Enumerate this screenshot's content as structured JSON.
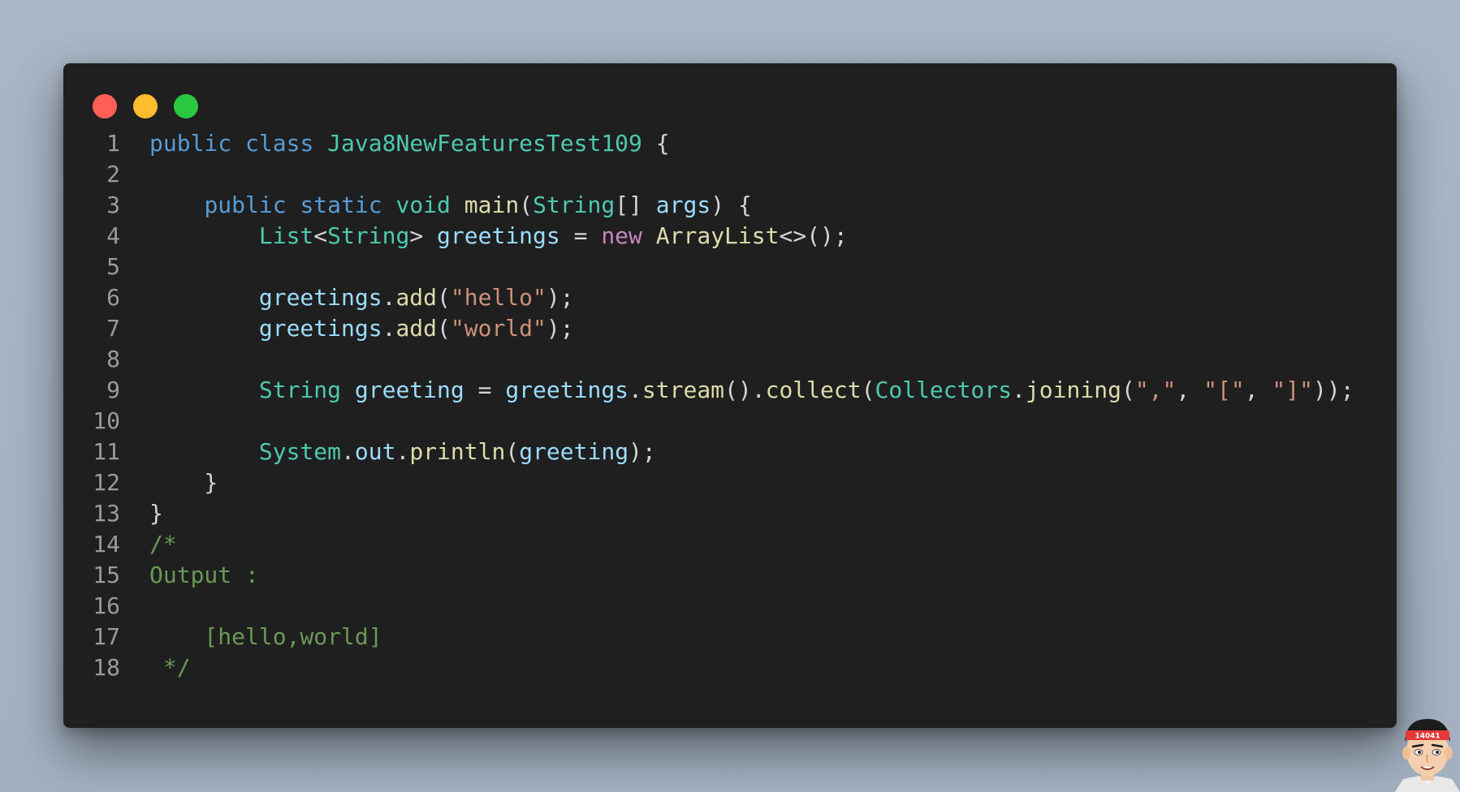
{
  "window": {
    "controls": [
      {
        "name": "close",
        "color": "#ff5f57"
      },
      {
        "name": "minimize",
        "color": "#febc2e"
      },
      {
        "name": "maximize",
        "color": "#28c840"
      }
    ]
  },
  "theme": {
    "keyword": "#569cd6",
    "type": "#4ec9b0",
    "func": "#dcdcaa",
    "var": "#9cdcfe",
    "string": "#ce9178",
    "comment": "#6a9955",
    "new": "#c586c0",
    "punct": "#d4d4d4",
    "line_number": "#9a9a9a"
  },
  "code": {
    "lines": [
      {
        "n": "1",
        "tokens": [
          [
            "kw",
            "public"
          ],
          [
            "p",
            " "
          ],
          [
            "kw",
            "class"
          ],
          [
            "p",
            " "
          ],
          [
            "ty",
            "Java8NewFeaturesTest109"
          ],
          [
            "p",
            " {"
          ]
        ]
      },
      {
        "n": "2",
        "tokens": []
      },
      {
        "n": "3",
        "tokens": [
          [
            "p",
            "    "
          ],
          [
            "kw",
            "public"
          ],
          [
            "p",
            " "
          ],
          [
            "kw",
            "static"
          ],
          [
            "p",
            " "
          ],
          [
            "ty",
            "void"
          ],
          [
            "p",
            " "
          ],
          [
            "fn",
            "main"
          ],
          [
            "p",
            "("
          ],
          [
            "ty",
            "String"
          ],
          [
            "p",
            "[] "
          ],
          [
            "var",
            "args"
          ],
          [
            "p",
            ") {"
          ]
        ]
      },
      {
        "n": "4",
        "tokens": [
          [
            "p",
            "        "
          ],
          [
            "ty",
            "List"
          ],
          [
            "p",
            "<"
          ],
          [
            "ty",
            "String"
          ],
          [
            "p",
            "> "
          ],
          [
            "var",
            "greetings"
          ],
          [
            "p",
            " = "
          ],
          [
            "new",
            "new"
          ],
          [
            "p",
            " "
          ],
          [
            "fn",
            "ArrayList"
          ],
          [
            "p",
            "<>();"
          ]
        ]
      },
      {
        "n": "5",
        "tokens": []
      },
      {
        "n": "6",
        "tokens": [
          [
            "p",
            "        "
          ],
          [
            "var",
            "greetings"
          ],
          [
            "p",
            "."
          ],
          [
            "fn",
            "add"
          ],
          [
            "p",
            "("
          ],
          [
            "str",
            "\"hello\""
          ],
          [
            "p",
            ");"
          ]
        ]
      },
      {
        "n": "7",
        "tokens": [
          [
            "p",
            "        "
          ],
          [
            "var",
            "greetings"
          ],
          [
            "p",
            "."
          ],
          [
            "fn",
            "add"
          ],
          [
            "p",
            "("
          ],
          [
            "str",
            "\"world\""
          ],
          [
            "p",
            ");"
          ]
        ]
      },
      {
        "n": "8",
        "tokens": []
      },
      {
        "n": "9",
        "tokens": [
          [
            "p",
            "        "
          ],
          [
            "ty",
            "String"
          ],
          [
            "p",
            " "
          ],
          [
            "var",
            "greeting"
          ],
          [
            "p",
            " = "
          ],
          [
            "var",
            "greetings"
          ],
          [
            "p",
            "."
          ],
          [
            "fn",
            "stream"
          ],
          [
            "p",
            "()."
          ],
          [
            "fn",
            "collect"
          ],
          [
            "p",
            "("
          ],
          [
            "ty",
            "Collectors"
          ],
          [
            "p",
            "."
          ],
          [
            "fn",
            "joining"
          ],
          [
            "p",
            "("
          ],
          [
            "str",
            "\",\""
          ],
          [
            "p",
            ", "
          ],
          [
            "str",
            "\"[\""
          ],
          [
            "p",
            ", "
          ],
          [
            "str",
            "\"]\""
          ],
          [
            "p",
            "));"
          ]
        ]
      },
      {
        "n": "10",
        "tokens": []
      },
      {
        "n": "11",
        "tokens": [
          [
            "p",
            "        "
          ],
          [
            "ty",
            "System"
          ],
          [
            "p",
            "."
          ],
          [
            "var",
            "out"
          ],
          [
            "p",
            "."
          ],
          [
            "fn",
            "println"
          ],
          [
            "p",
            "("
          ],
          [
            "var",
            "greeting"
          ],
          [
            "p",
            ");"
          ]
        ]
      },
      {
        "n": "12",
        "tokens": [
          [
            "p",
            "    }"
          ]
        ]
      },
      {
        "n": "13",
        "tokens": [
          [
            "p",
            "}"
          ]
        ]
      },
      {
        "n": "14",
        "tokens": [
          [
            "cm",
            "/*"
          ]
        ]
      },
      {
        "n": "15",
        "tokens": [
          [
            "cm",
            "Output :"
          ]
        ]
      },
      {
        "n": "16",
        "tokens": []
      },
      {
        "n": "17",
        "tokens": [
          [
            "cm",
            "    [hello,world]"
          ]
        ]
      },
      {
        "n": "18",
        "tokens": [
          [
            "cm",
            " */"
          ]
        ]
      }
    ]
  },
  "avatar": {
    "badge_text": "14041"
  }
}
